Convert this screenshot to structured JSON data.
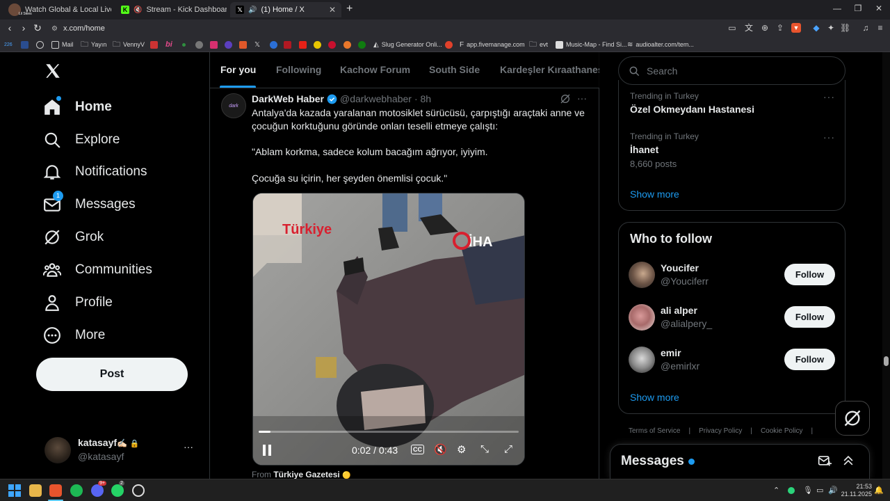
{
  "browser": {
    "tabs": [
      {
        "label": "Watch Global & Local Live TV On",
        "active": false
      },
      {
        "label": "Stream - Kick Dashboard",
        "active": false
      },
      {
        "label": "(1) Home / X",
        "active": true
      }
    ],
    "tab_avatar_label": "Lil Skies",
    "new_tab_symbol": "+",
    "url": "x.com/home",
    "bookmarks": [
      "Mail",
      "Yayın",
      "VennyV",
      "Slug Generator Onli...",
      "app.fivemanage.com",
      "evt",
      "Music-Map - Find Si...",
      "audioalter.com/tem..."
    ],
    "bookmark_badge": "226"
  },
  "sidebar": {
    "nav": [
      {
        "label": "Home",
        "icon": "home-icon",
        "bold": true
      },
      {
        "label": "Explore",
        "icon": "search-icon"
      },
      {
        "label": "Notifications",
        "icon": "bell-icon"
      },
      {
        "label": "Messages",
        "icon": "mail-icon",
        "badge": "1"
      },
      {
        "label": "Grok",
        "icon": "grok-icon"
      },
      {
        "label": "Communities",
        "icon": "communities-icon"
      },
      {
        "label": "Profile",
        "icon": "profile-icon"
      },
      {
        "label": "More",
        "icon": "more-icon"
      }
    ],
    "post_label": "Post",
    "account": {
      "name": "katasayf",
      "emoji": "✍🏻",
      "handle": "@katasayf",
      "more": "···"
    }
  },
  "feed": {
    "tabs": [
      "For you",
      "Following",
      "Kachow Forum",
      "South Side",
      "Kardeşler Kıraathanesi"
    ],
    "tweet": {
      "author": "DarkWeb Haber",
      "handle": "@darkwebhaber",
      "time": "· 8h",
      "more": "···",
      "text_1": "Antalya'da kazada yaralanan motosiklet sürücüsü, çarpıştığı araçtaki anne ve çocuğun korktuğunu göründe onları teselli etmeye çalıştı:",
      "text_2": "\"Ablam korkma, sadece kolum bacağım ağrıyor, iyiyim.",
      "text_3": "Çocuğa su içirin, her şeyden önemlisi çocuk.\"",
      "video": {
        "watermark_left": "Türkiye",
        "watermark_right": "İHA",
        "time": "0:02 / 0:43",
        "progress": 0.046
      },
      "source_prefix": "From",
      "source_name": "Türkiye Gazetesi"
    }
  },
  "right": {
    "search_placeholder": "Search",
    "trends": [
      {
        "meta": "Trending in Turkey",
        "title": "Özel Okmeydanı Hastanesi",
        "posts": ""
      },
      {
        "meta": "Trending in Turkey",
        "title": "İhanet",
        "posts": "8,660 posts"
      }
    ],
    "trends_show_more": "Show more",
    "who_to_follow": {
      "title": "Who to follow",
      "users": [
        {
          "name": "Youcifer",
          "handle": "@Youciferr",
          "button": "Follow"
        },
        {
          "name": "ali alper",
          "handle": "@alialpery_",
          "button": "Follow"
        },
        {
          "name": "emir",
          "handle": "@emirlxr",
          "button": "Follow"
        }
      ],
      "show_more": "Show more"
    },
    "footer": [
      "Terms of Service",
      "|",
      "Privacy Policy",
      "|",
      "Cookie Policy",
      "|"
    ],
    "messages_drawer": {
      "title": "Messages"
    }
  },
  "taskbar": {
    "time": "21:53",
    "date": "21.11.2025",
    "discord_badge": "9+",
    "whatsapp_badge": "2"
  },
  "colors": {
    "accent": "#1d9bf0",
    "background": "#000000",
    "text": "#e7e9ea",
    "muted": "#71767b",
    "border": "#2f3336"
  }
}
